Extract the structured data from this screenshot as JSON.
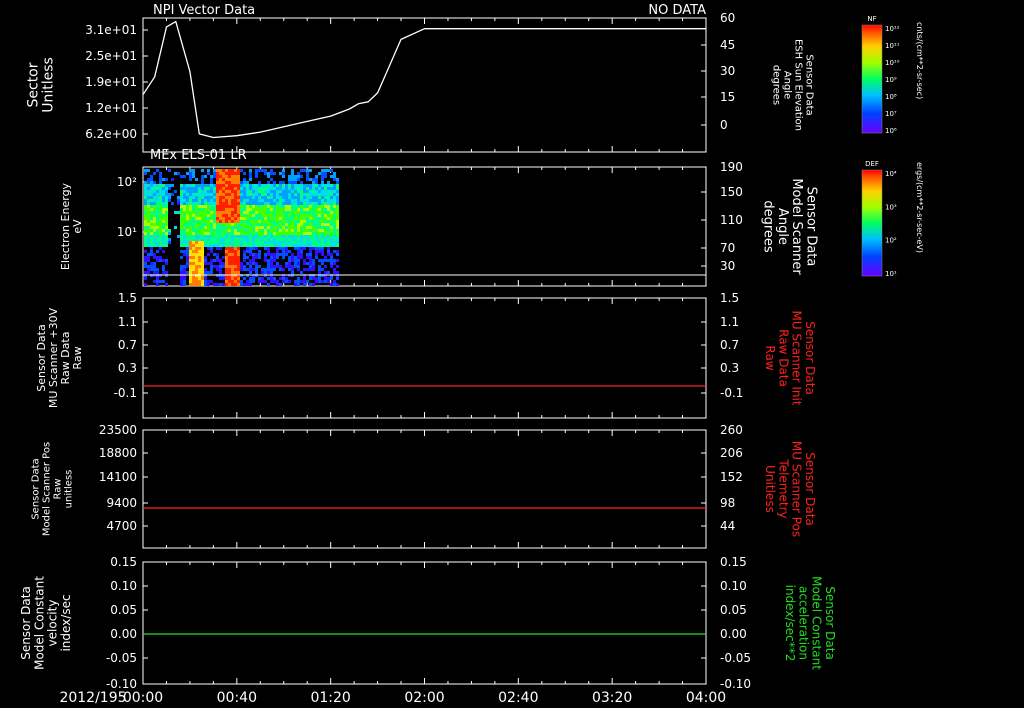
{
  "colors": {
    "white": "#ffffff",
    "red": "#ff2020",
    "green": "#22dd22"
  },
  "date_label": "2012/195",
  "x_ticks": [
    "00:00",
    "00:40",
    "01:20",
    "02:00",
    "02:40",
    "03:20",
    "04:00"
  ],
  "colorbars": [
    {
      "label": "NF",
      "unit": "cnts/(cm**2-sr-sec)",
      "ticks": [
        "10¹²",
        "10¹¹",
        "10¹⁰",
        "10⁹",
        "10⁸",
        "10⁷",
        "10⁶"
      ]
    },
    {
      "label": "DEF",
      "unit": "ergs/(cm**2-sr-sec-eV)",
      "ticks": [
        "10⁴",
        "10³",
        "10²",
        "10¹"
      ]
    }
  ],
  "chart_data": [
    {
      "type": "line",
      "title": "NPI Vector Data",
      "status": "NO DATA",
      "ylabel": [
        "Sector",
        "Unitless"
      ],
      "yticks": [
        "3.1e+01",
        "2.5e+01",
        "1.9e+01",
        "1.2e+01",
        "6.2e+00"
      ],
      "y2label": [
        "Sensor Data",
        "ESH Sun Elevation",
        "Angle",
        "degrees"
      ],
      "y2ticks": [
        "60",
        "45",
        "30",
        "15",
        "0"
      ],
      "y2lim": [
        -15,
        60
      ],
      "series": [
        {
          "x": [
            0,
            5,
            10,
            14,
            20,
            24,
            30,
            40,
            50,
            60,
            70,
            80,
            88,
            92,
            96,
            100,
            104,
            110,
            120,
            140,
            180,
            240
          ],
          "values": [
            17,
            27,
            55,
            58,
            30,
            -5,
            -7,
            -6,
            -4,
            -1,
            2,
            5,
            9,
            12,
            13,
            18,
            30,
            48,
            54,
            54,
            54,
            54
          ]
        }
      ]
    },
    {
      "type": "heatmap",
      "title": "MEx ELS-01 LR",
      "ylabel": [
        "Electron Energy",
        "eV"
      ],
      "yticks": [
        "10²",
        "10¹"
      ],
      "y2label": [
        "Sensor Data",
        "Model Scanner",
        "Angle",
        "degrees"
      ],
      "y2ticks": [
        "190",
        "150",
        "110",
        "70",
        "30"
      ],
      "data_x_range": [
        0,
        83
      ],
      "hline_y2": 14
    },
    {
      "type": "line",
      "ylabel": [
        "Sensor Data",
        "MU Scanner +30V",
        "Raw Data",
        "Raw"
      ],
      "yticks": [
        "1.5",
        "1.1",
        "0.7",
        "0.3",
        "-0.1"
      ],
      "ylim": [
        -0.3,
        1.5
      ],
      "y2label": [
        "Sensor Data",
        "MU Scanner Init",
        "Raw Data",
        "Raw"
      ],
      "y2ticks": [
        "1.5",
        "1.1",
        "0.7",
        "0.3",
        "-0.1"
      ],
      "series": [
        {
          "x": [
            0,
            240
          ],
          "values": [
            0,
            0
          ]
        }
      ]
    },
    {
      "type": "line",
      "ylabel": [
        "Sensor Data",
        "Model Scanner Pos",
        "Raw",
        "unitless"
      ],
      "yticks": [
        "23500",
        "18800",
        "14100",
        "9400",
        "4700"
      ],
      "ylim": [
        0,
        23500
      ],
      "y2label": [
        "Sensor Data",
        "MU Scanner Pos",
        "Telemetry",
        "Unitless"
      ],
      "y2ticks": [
        "260",
        "206",
        "152",
        "98",
        "44"
      ],
      "series": [
        {
          "x": [
            0,
            240
          ],
          "values": [
            7050,
            7050
          ]
        }
      ]
    },
    {
      "type": "line",
      "ylabel": [
        "Sensor Data",
        "Model Constant",
        "velocity",
        "index/sec"
      ],
      "yticks": [
        "0.15",
        "0.10",
        "0.05",
        "0.00",
        "-0.05",
        "-0.10"
      ],
      "ylim": [
        -0.1,
        0.15
      ],
      "y2label": [
        "Sensor Data",
        "Model Constant",
        "acceleration",
        "index/sec**2"
      ],
      "y2ticks": [
        "0.15",
        "0.10",
        "0.05",
        "0.00",
        "-0.05",
        "-0.10"
      ],
      "series": [
        {
          "x": [
            0,
            240
          ],
          "values": [
            0,
            0
          ]
        }
      ]
    }
  ]
}
